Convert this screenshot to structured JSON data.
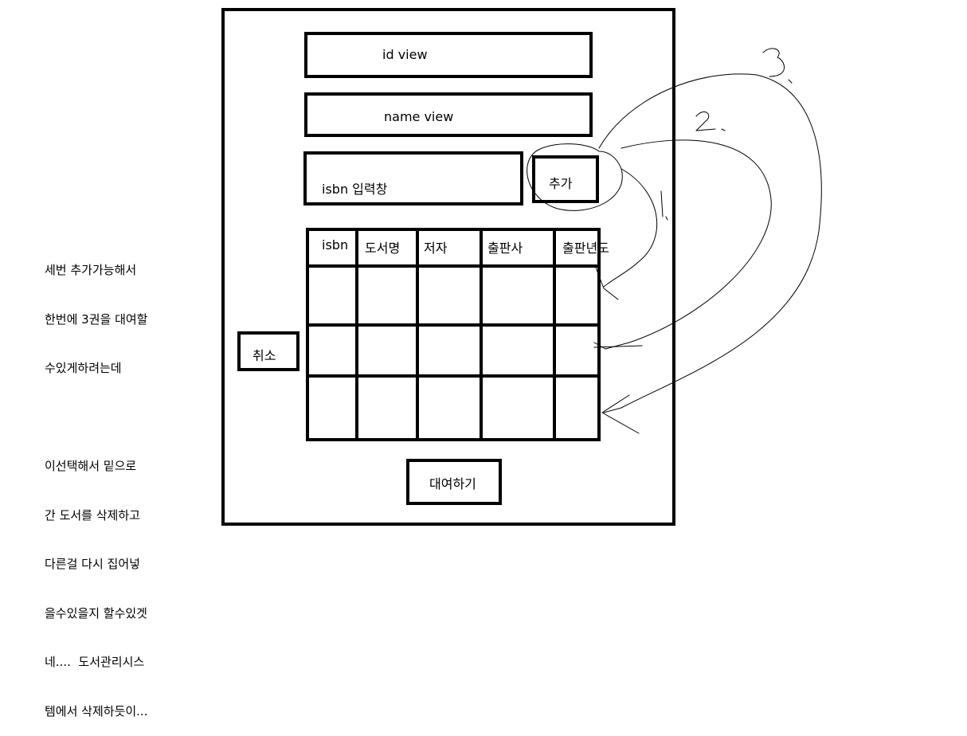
{
  "fields": {
    "id_view": "id view",
    "name_view": "name view",
    "isbn_input": "isbn 입력창"
  },
  "buttons": {
    "add": "추가",
    "cancel": "취소",
    "rent": "대여하기"
  },
  "table": {
    "headers": [
      "isbn",
      "도서명",
      "저자",
      "출판사",
      "출판년도"
    ]
  },
  "note": {
    "lines": [
      "세번 추가가능해서",
      "한번에 3권을 대여할",
      "수있게하려는데",
      "",
      "이선택해서 밑으로",
      "간 도서를 삭제하고",
      "다른걸 다시 집어넣",
      "을수있을지 할수있겟",
      "네....  도서관리시스",
      "템에서 삭제하듯이..."
    ]
  },
  "arrows": {
    "labels": [
      "1.",
      "2.",
      "3."
    ]
  }
}
